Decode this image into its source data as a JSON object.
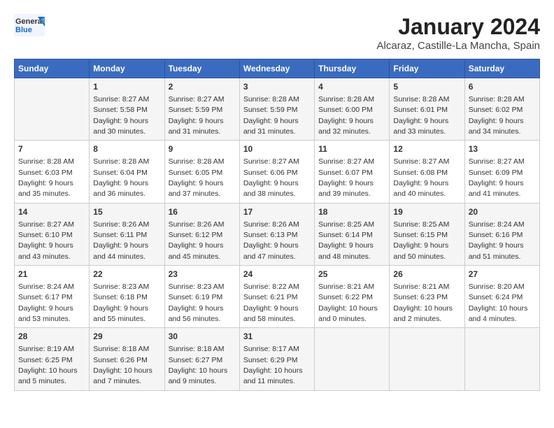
{
  "header": {
    "logo_general": "General",
    "logo_blue": "Blue",
    "title": "January 2024",
    "subtitle": "Alcaraz, Castille-La Mancha, Spain"
  },
  "calendar": {
    "days": [
      "Sunday",
      "Monday",
      "Tuesday",
      "Wednesday",
      "Thursday",
      "Friday",
      "Saturday"
    ],
    "weeks": [
      [
        {
          "date": "",
          "content": ""
        },
        {
          "date": "1",
          "content": "Sunrise: 8:27 AM\nSunset: 5:58 PM\nDaylight: 9 hours\nand 30 minutes."
        },
        {
          "date": "2",
          "content": "Sunrise: 8:27 AM\nSunset: 5:59 PM\nDaylight: 9 hours\nand 31 minutes."
        },
        {
          "date": "3",
          "content": "Sunrise: 8:28 AM\nSunset: 5:59 PM\nDaylight: 9 hours\nand 31 minutes."
        },
        {
          "date": "4",
          "content": "Sunrise: 8:28 AM\nSunset: 6:00 PM\nDaylight: 9 hours\nand 32 minutes."
        },
        {
          "date": "5",
          "content": "Sunrise: 8:28 AM\nSunset: 6:01 PM\nDaylight: 9 hours\nand 33 minutes."
        },
        {
          "date": "6",
          "content": "Sunrise: 8:28 AM\nSunset: 6:02 PM\nDaylight: 9 hours\nand 34 minutes."
        }
      ],
      [
        {
          "date": "7",
          "content": "Sunrise: 8:28 AM\nSunset: 6:03 PM\nDaylight: 9 hours\nand 35 minutes."
        },
        {
          "date": "8",
          "content": "Sunrise: 8:28 AM\nSunset: 6:04 PM\nDaylight: 9 hours\nand 36 minutes."
        },
        {
          "date": "9",
          "content": "Sunrise: 8:28 AM\nSunset: 6:05 PM\nDaylight: 9 hours\nand 37 minutes."
        },
        {
          "date": "10",
          "content": "Sunrise: 8:27 AM\nSunset: 6:06 PM\nDaylight: 9 hours\nand 38 minutes."
        },
        {
          "date": "11",
          "content": "Sunrise: 8:27 AM\nSunset: 6:07 PM\nDaylight: 9 hours\nand 39 minutes."
        },
        {
          "date": "12",
          "content": "Sunrise: 8:27 AM\nSunset: 6:08 PM\nDaylight: 9 hours\nand 40 minutes."
        },
        {
          "date": "13",
          "content": "Sunrise: 8:27 AM\nSunset: 6:09 PM\nDaylight: 9 hours\nand 41 minutes."
        }
      ],
      [
        {
          "date": "14",
          "content": "Sunrise: 8:27 AM\nSunset: 6:10 PM\nDaylight: 9 hours\nand 43 minutes."
        },
        {
          "date": "15",
          "content": "Sunrise: 8:26 AM\nSunset: 6:11 PM\nDaylight: 9 hours\nand 44 minutes."
        },
        {
          "date": "16",
          "content": "Sunrise: 8:26 AM\nSunset: 6:12 PM\nDaylight: 9 hours\nand 45 minutes."
        },
        {
          "date": "17",
          "content": "Sunrise: 8:26 AM\nSunset: 6:13 PM\nDaylight: 9 hours\nand 47 minutes."
        },
        {
          "date": "18",
          "content": "Sunrise: 8:25 AM\nSunset: 6:14 PM\nDaylight: 9 hours\nand 48 minutes."
        },
        {
          "date": "19",
          "content": "Sunrise: 8:25 AM\nSunset: 6:15 PM\nDaylight: 9 hours\nand 50 minutes."
        },
        {
          "date": "20",
          "content": "Sunrise: 8:24 AM\nSunset: 6:16 PM\nDaylight: 9 hours\nand 51 minutes."
        }
      ],
      [
        {
          "date": "21",
          "content": "Sunrise: 8:24 AM\nSunset: 6:17 PM\nDaylight: 9 hours\nand 53 minutes."
        },
        {
          "date": "22",
          "content": "Sunrise: 8:23 AM\nSunset: 6:18 PM\nDaylight: 9 hours\nand 55 minutes."
        },
        {
          "date": "23",
          "content": "Sunrise: 8:23 AM\nSunset: 6:19 PM\nDaylight: 9 hours\nand 56 minutes."
        },
        {
          "date": "24",
          "content": "Sunrise: 8:22 AM\nSunset: 6:21 PM\nDaylight: 9 hours\nand 58 minutes."
        },
        {
          "date": "25",
          "content": "Sunrise: 8:21 AM\nSunset: 6:22 PM\nDaylight: 10 hours\nand 0 minutes."
        },
        {
          "date": "26",
          "content": "Sunrise: 8:21 AM\nSunset: 6:23 PM\nDaylight: 10 hours\nand 2 minutes."
        },
        {
          "date": "27",
          "content": "Sunrise: 8:20 AM\nSunset: 6:24 PM\nDaylight: 10 hours\nand 4 minutes."
        }
      ],
      [
        {
          "date": "28",
          "content": "Sunrise: 8:19 AM\nSunset: 6:25 PM\nDaylight: 10 hours\nand 5 minutes."
        },
        {
          "date": "29",
          "content": "Sunrise: 8:18 AM\nSunset: 6:26 PM\nDaylight: 10 hours\nand 7 minutes."
        },
        {
          "date": "30",
          "content": "Sunrise: 8:18 AM\nSunset: 6:27 PM\nDaylight: 10 hours\nand 9 minutes."
        },
        {
          "date": "31",
          "content": "Sunrise: 8:17 AM\nSunset: 6:29 PM\nDaylight: 10 hours\nand 11 minutes."
        },
        {
          "date": "",
          "content": ""
        },
        {
          "date": "",
          "content": ""
        },
        {
          "date": "",
          "content": ""
        }
      ]
    ]
  }
}
